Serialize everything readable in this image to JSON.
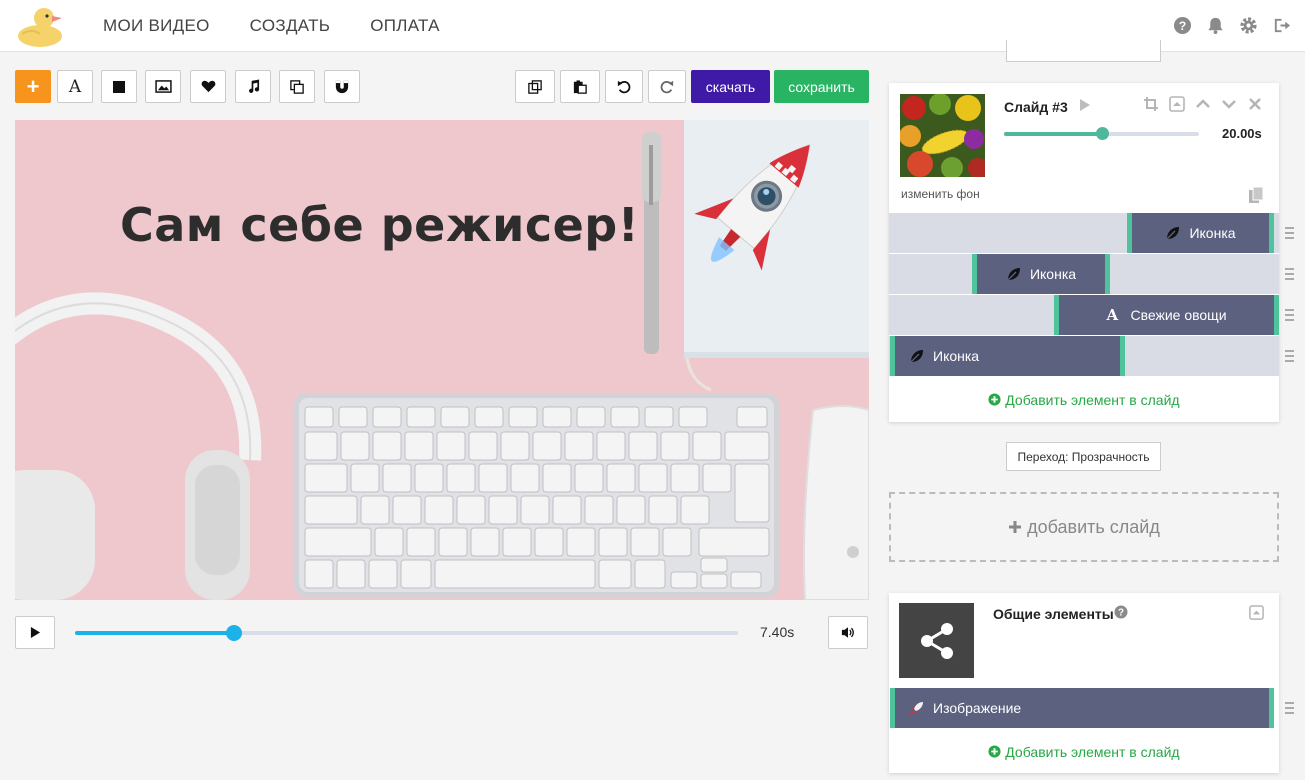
{
  "nav": {
    "my_videos": "МОИ ВИДЕО",
    "create": "СОЗДАТЬ",
    "payment": "ОПЛАТА"
  },
  "toolbar": {
    "download_label": "скачать",
    "save_label": "сохранить",
    "add_label": "+",
    "text_label": "A"
  },
  "canvas": {
    "title_text": "Сам себе режисер!"
  },
  "player": {
    "time_label": "7.40s",
    "progress": 0.24
  },
  "slide": {
    "title": "Слайд #3",
    "change_bg": "изменить фон",
    "duration_label": "20.00s",
    "duration_progress": 0.5,
    "elements": [
      {
        "label": "Иконка",
        "icon": "leaf-icon"
      },
      {
        "label": "Иконка",
        "icon": "leaf-icon"
      },
      {
        "label": "Свежие овощи",
        "icon": "text-icon"
      },
      {
        "label": "Иконка",
        "icon": "leaf-icon"
      }
    ],
    "add_element": "Добавить элемент в слайд"
  },
  "transition": {
    "label": "Переход: Прозрачность"
  },
  "add_slide": {
    "label": "добавить слайд"
  },
  "common": {
    "title": "Общие элементы",
    "elements": [
      {
        "label": "Изображение",
        "icon": "rocket-icon"
      }
    ],
    "add_element": "Добавить элемент в слайд"
  },
  "colors": {
    "accent_orange": "#f7941d",
    "download_purple": "#3f1aa6",
    "save_green": "#28b463",
    "progress_blue": "#1ab2e8",
    "element_bar": "#5c617f",
    "element_edge": "#4fc39b",
    "canvas_bg": "#efc8ce"
  }
}
